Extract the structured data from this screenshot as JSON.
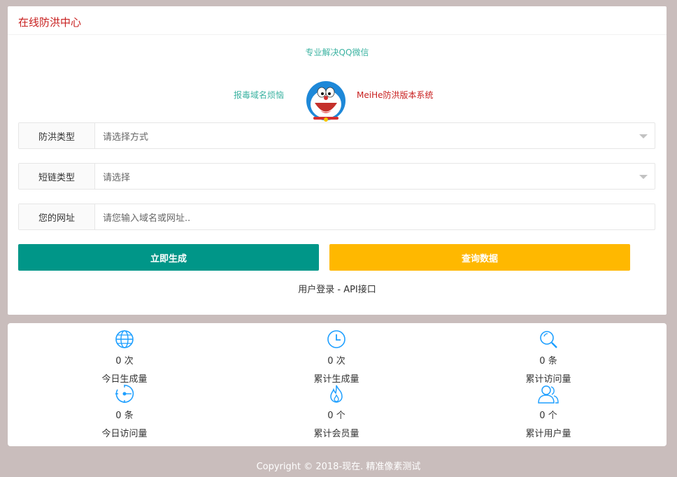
{
  "header": {
    "title": "在线防洪中心"
  },
  "promo": {
    "top": "专业解决QQ微信",
    "left": "报毒域名烦恼",
    "right": "MeiHe防洪版本系统"
  },
  "form": {
    "type_label": "防洪类型",
    "type_value": "请选择方式",
    "shortlink_label": "短链类型",
    "shortlink_value": "请选择",
    "url_label": "您的网址",
    "url_placeholder": "请您输入域名或网址.."
  },
  "buttons": {
    "generate": "立即生成",
    "query": "查询数据"
  },
  "links": {
    "login": "用户登录",
    "separator": " - ",
    "api": "API接口"
  },
  "stats": [
    {
      "icon": "globe-icon",
      "value": "0 次",
      "label": "今日生成量"
    },
    {
      "icon": "clock-icon",
      "value": "0 次",
      "label": "累计生成量"
    },
    {
      "icon": "search-icon",
      "value": "0 条",
      "label": "累计访问量"
    },
    {
      "icon": "target-icon",
      "value": "0 条",
      "label": "今日访问量"
    },
    {
      "icon": "fire-icon",
      "value": "0 个",
      "label": "累计会员量"
    },
    {
      "icon": "users-icon",
      "value": "0 个",
      "label": "累计用户量"
    }
  ],
  "footer": {
    "copyright": "Copyright © 2018-现在. 精准像素测试"
  },
  "colors": {
    "accent_red": "#c8201f",
    "accent_teal": "#3cb3a2",
    "primary_button": "#009688",
    "warning_button": "#ffb800",
    "icon_blue": "#1e9fff"
  }
}
